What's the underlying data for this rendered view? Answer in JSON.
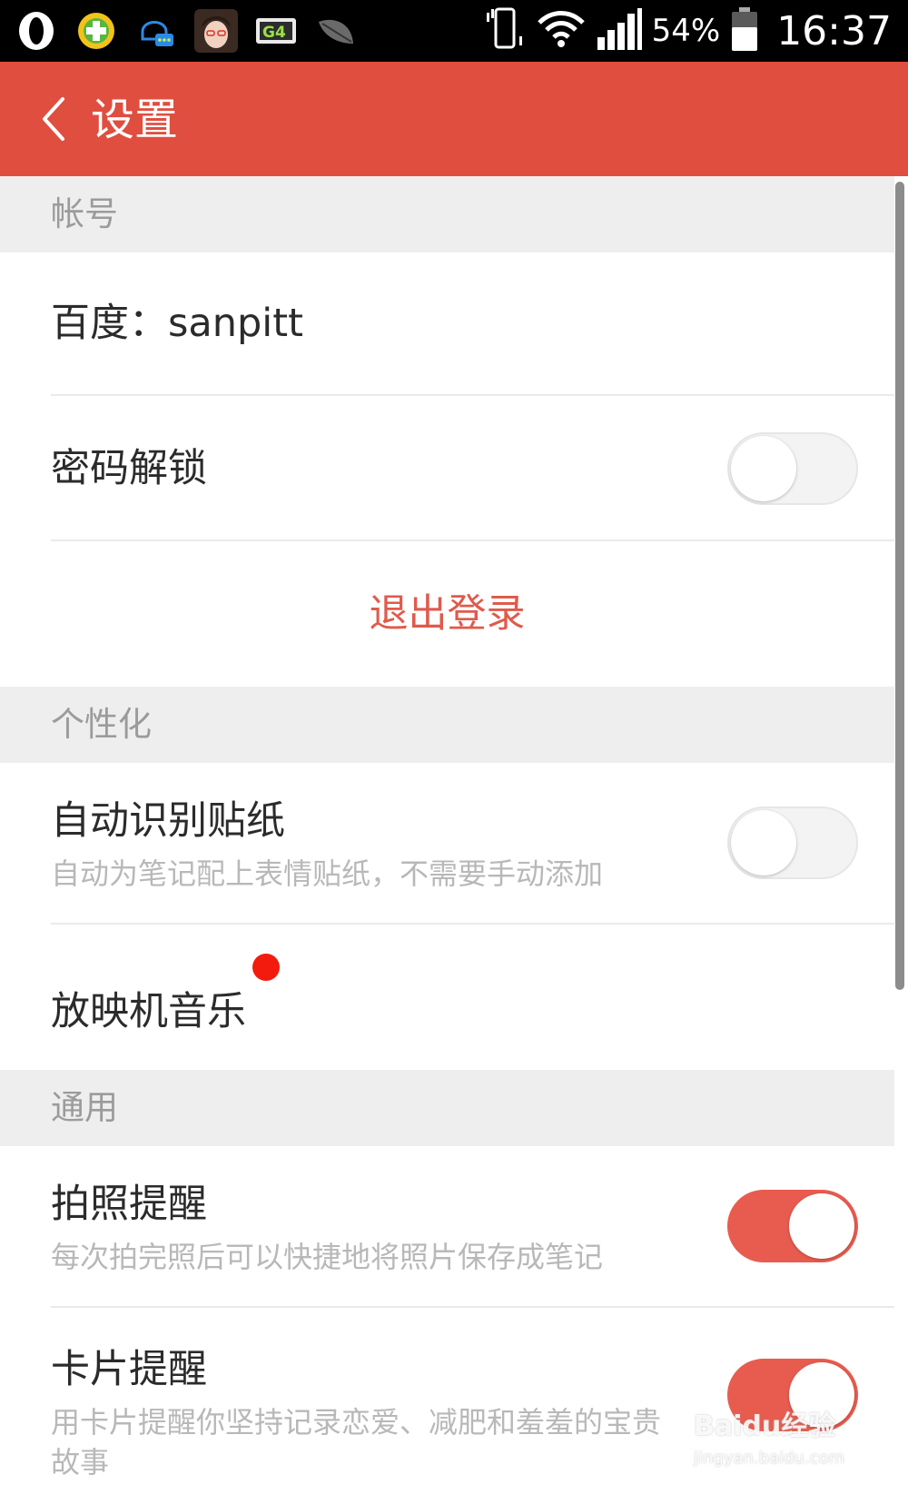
{
  "status_bar": {
    "battery_percent": "54%",
    "time": "16:37",
    "left_icons": [
      "opera-icon",
      "plus-app-icon",
      "qq-chat-icon",
      "avatar-icon",
      "g4-app-icon",
      "leaf-icon"
    ],
    "right_icons": [
      "vibrate-icon",
      "wifi-icon",
      "signal-icon",
      "battery-icon"
    ]
  },
  "app_bar": {
    "title": "设置",
    "back_icon": "chevron-left-icon",
    "color": "#e04e3f"
  },
  "sections": {
    "account": {
      "header": "帐号",
      "baidu_account": "百度：sanpitt",
      "password_lock": {
        "label": "密码解锁",
        "enabled": false
      },
      "logout_label": "退出登录"
    },
    "personalization": {
      "header": "个性化",
      "auto_sticker": {
        "label": "自动识别贴纸",
        "description": "自动为笔记配上表情贴纸，不需要手动添加",
        "enabled": false
      },
      "projector_music": {
        "label": "放映机音乐",
        "has_badge": true
      }
    },
    "general": {
      "header": "通用",
      "photo_reminder": {
        "label": "拍照提醒",
        "description": "每次拍完照后可以快捷地将照片保存成笔记",
        "enabled": true
      },
      "card_reminder": {
        "label": "卡片提醒",
        "description": "用卡片提醒你坚持记录恋爱、减肥和羞羞的宝贵故事",
        "enabled": true
      }
    }
  },
  "watermark": {
    "brand": "Baidu经验",
    "url": "jingyan.baidu.com"
  },
  "colors": {
    "accent": "#e04e3f",
    "toggle_on": "#e85c4f",
    "badge": "#f21b0d"
  }
}
